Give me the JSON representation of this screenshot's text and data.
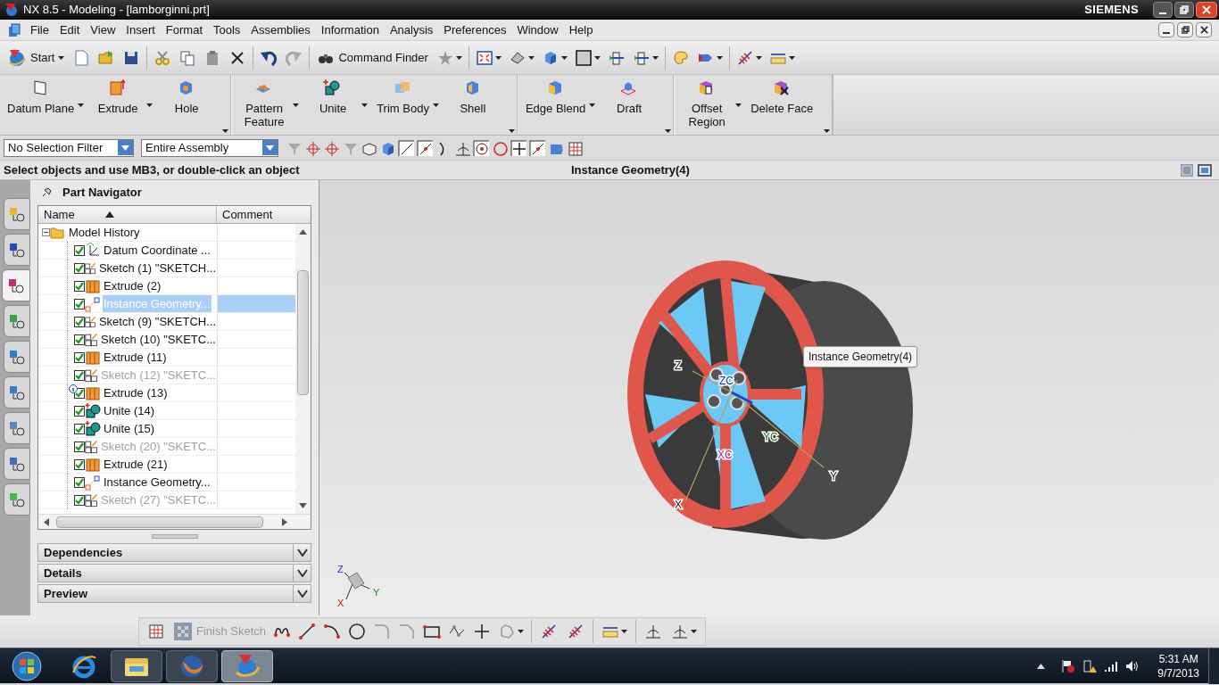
{
  "window": {
    "title": "NX 8.5 - Modeling - [lamborginni.prt]",
    "brand": "SIEMENS"
  },
  "menu": [
    "File",
    "Edit",
    "View",
    "Insert",
    "Format",
    "Tools",
    "Assemblies",
    "Information",
    "Analysis",
    "Preferences",
    "Window",
    "Help"
  ],
  "standard_toolbar": {
    "start": "Start",
    "command_finder": "Command Finder"
  },
  "ribbon_groups": [
    [
      {
        "label": "Datum Plane",
        "dropdown": true
      },
      {
        "label": "Extrude",
        "dropdown": true
      },
      {
        "label": "Hole",
        "dropdown": false
      }
    ],
    [
      {
        "label": "Pattern\nFeature",
        "dropdown": true
      },
      {
        "label": "Unite",
        "dropdown": true
      },
      {
        "label": "Trim Body",
        "dropdown": true
      },
      {
        "label": "Shell",
        "dropdown": false
      }
    ],
    [
      {
        "label": "Edge Blend",
        "dropdown": true
      },
      {
        "label": "Draft",
        "dropdown": false
      }
    ],
    [
      {
        "label": "Offset\nRegion",
        "dropdown": true
      },
      {
        "label": "Delete Face",
        "dropdown": false
      }
    ]
  ],
  "selection_bar": {
    "filter": "No Selection Filter",
    "scope": "Entire Assembly"
  },
  "cue_line": "Select objects and use MB3, or double-click an object",
  "status_line": "Instance Geometry(4)",
  "resource_tabs": [
    {
      "selected": false
    },
    {
      "selected": false
    },
    {
      "selected": true
    },
    {
      "selected": false
    },
    {
      "selected": false
    },
    {
      "selected": false
    },
    {
      "selected": false
    },
    {
      "selected": false
    },
    {
      "selected": false
    }
  ],
  "navigator": {
    "title": "Part Navigator",
    "columns": [
      "Name",
      "Comment"
    ],
    "root": {
      "label": "Model History",
      "expanded": true,
      "children": [
        {
          "label": "Datum Coordinate ...",
          "kind": "datum",
          "checked": true,
          "dimmed": false,
          "selected": false,
          "info": false
        },
        {
          "label": "Sketch (1) \"SKETCH...",
          "kind": "sketch",
          "checked": true,
          "dimmed": false,
          "selected": false,
          "info": false
        },
        {
          "label": "Extrude (2)",
          "kind": "extrude",
          "checked": true,
          "dimmed": false,
          "selected": false,
          "info": false
        },
        {
          "label": "Instance Geometry...",
          "kind": "instance",
          "checked": true,
          "dimmed": false,
          "selected": true,
          "info": false
        },
        {
          "label": "Sketch (9) \"SKETCH...",
          "kind": "sketch",
          "checked": true,
          "dimmed": false,
          "selected": false,
          "info": false
        },
        {
          "label": "Sketch (10) \"SKETC...",
          "kind": "sketch",
          "checked": true,
          "dimmed": false,
          "selected": false,
          "info": false
        },
        {
          "label": "Extrude (11)",
          "kind": "extrude",
          "checked": true,
          "dimmed": false,
          "selected": false,
          "info": false
        },
        {
          "label": "Sketch (12) \"SKETC...",
          "kind": "sketch",
          "checked": true,
          "dimmed": true,
          "selected": false,
          "info": false
        },
        {
          "label": "Extrude (13)",
          "kind": "extrude",
          "checked": true,
          "dimmed": false,
          "selected": false,
          "info": true
        },
        {
          "label": "Unite (14)",
          "kind": "unite",
          "checked": true,
          "dimmed": false,
          "selected": false,
          "info": false
        },
        {
          "label": "Unite (15)",
          "kind": "unite",
          "checked": true,
          "dimmed": false,
          "selected": false,
          "info": false
        },
        {
          "label": "Sketch (20) \"SKETC...",
          "kind": "sketch",
          "checked": true,
          "dimmed": true,
          "selected": false,
          "info": false
        },
        {
          "label": "Extrude (21)",
          "kind": "extrude",
          "checked": true,
          "dimmed": false,
          "selected": false,
          "info": false
        },
        {
          "label": "Instance Geometry...",
          "kind": "instance",
          "checked": true,
          "dimmed": false,
          "selected": false,
          "info": false
        },
        {
          "label": "Sketch (27) \"SKETC...",
          "kind": "sketch",
          "checked": true,
          "dimmed": true,
          "selected": false,
          "info": false
        }
      ]
    },
    "panels": [
      "Dependencies",
      "Details",
      "Preview"
    ]
  },
  "viewport": {
    "tooltip": "Instance Geometry(4)",
    "wcs_labels": [
      "Z",
      "ZC",
      "XC",
      "YC",
      "Y",
      "X"
    ],
    "triad_labels": [
      "Z",
      "Y",
      "X"
    ]
  },
  "sketch_toolbar": {
    "finish_sketch": "Finish Sketch",
    "disabled": true
  },
  "taskbar": {
    "time": "5:31 AM",
    "date": "9/7/2013"
  }
}
